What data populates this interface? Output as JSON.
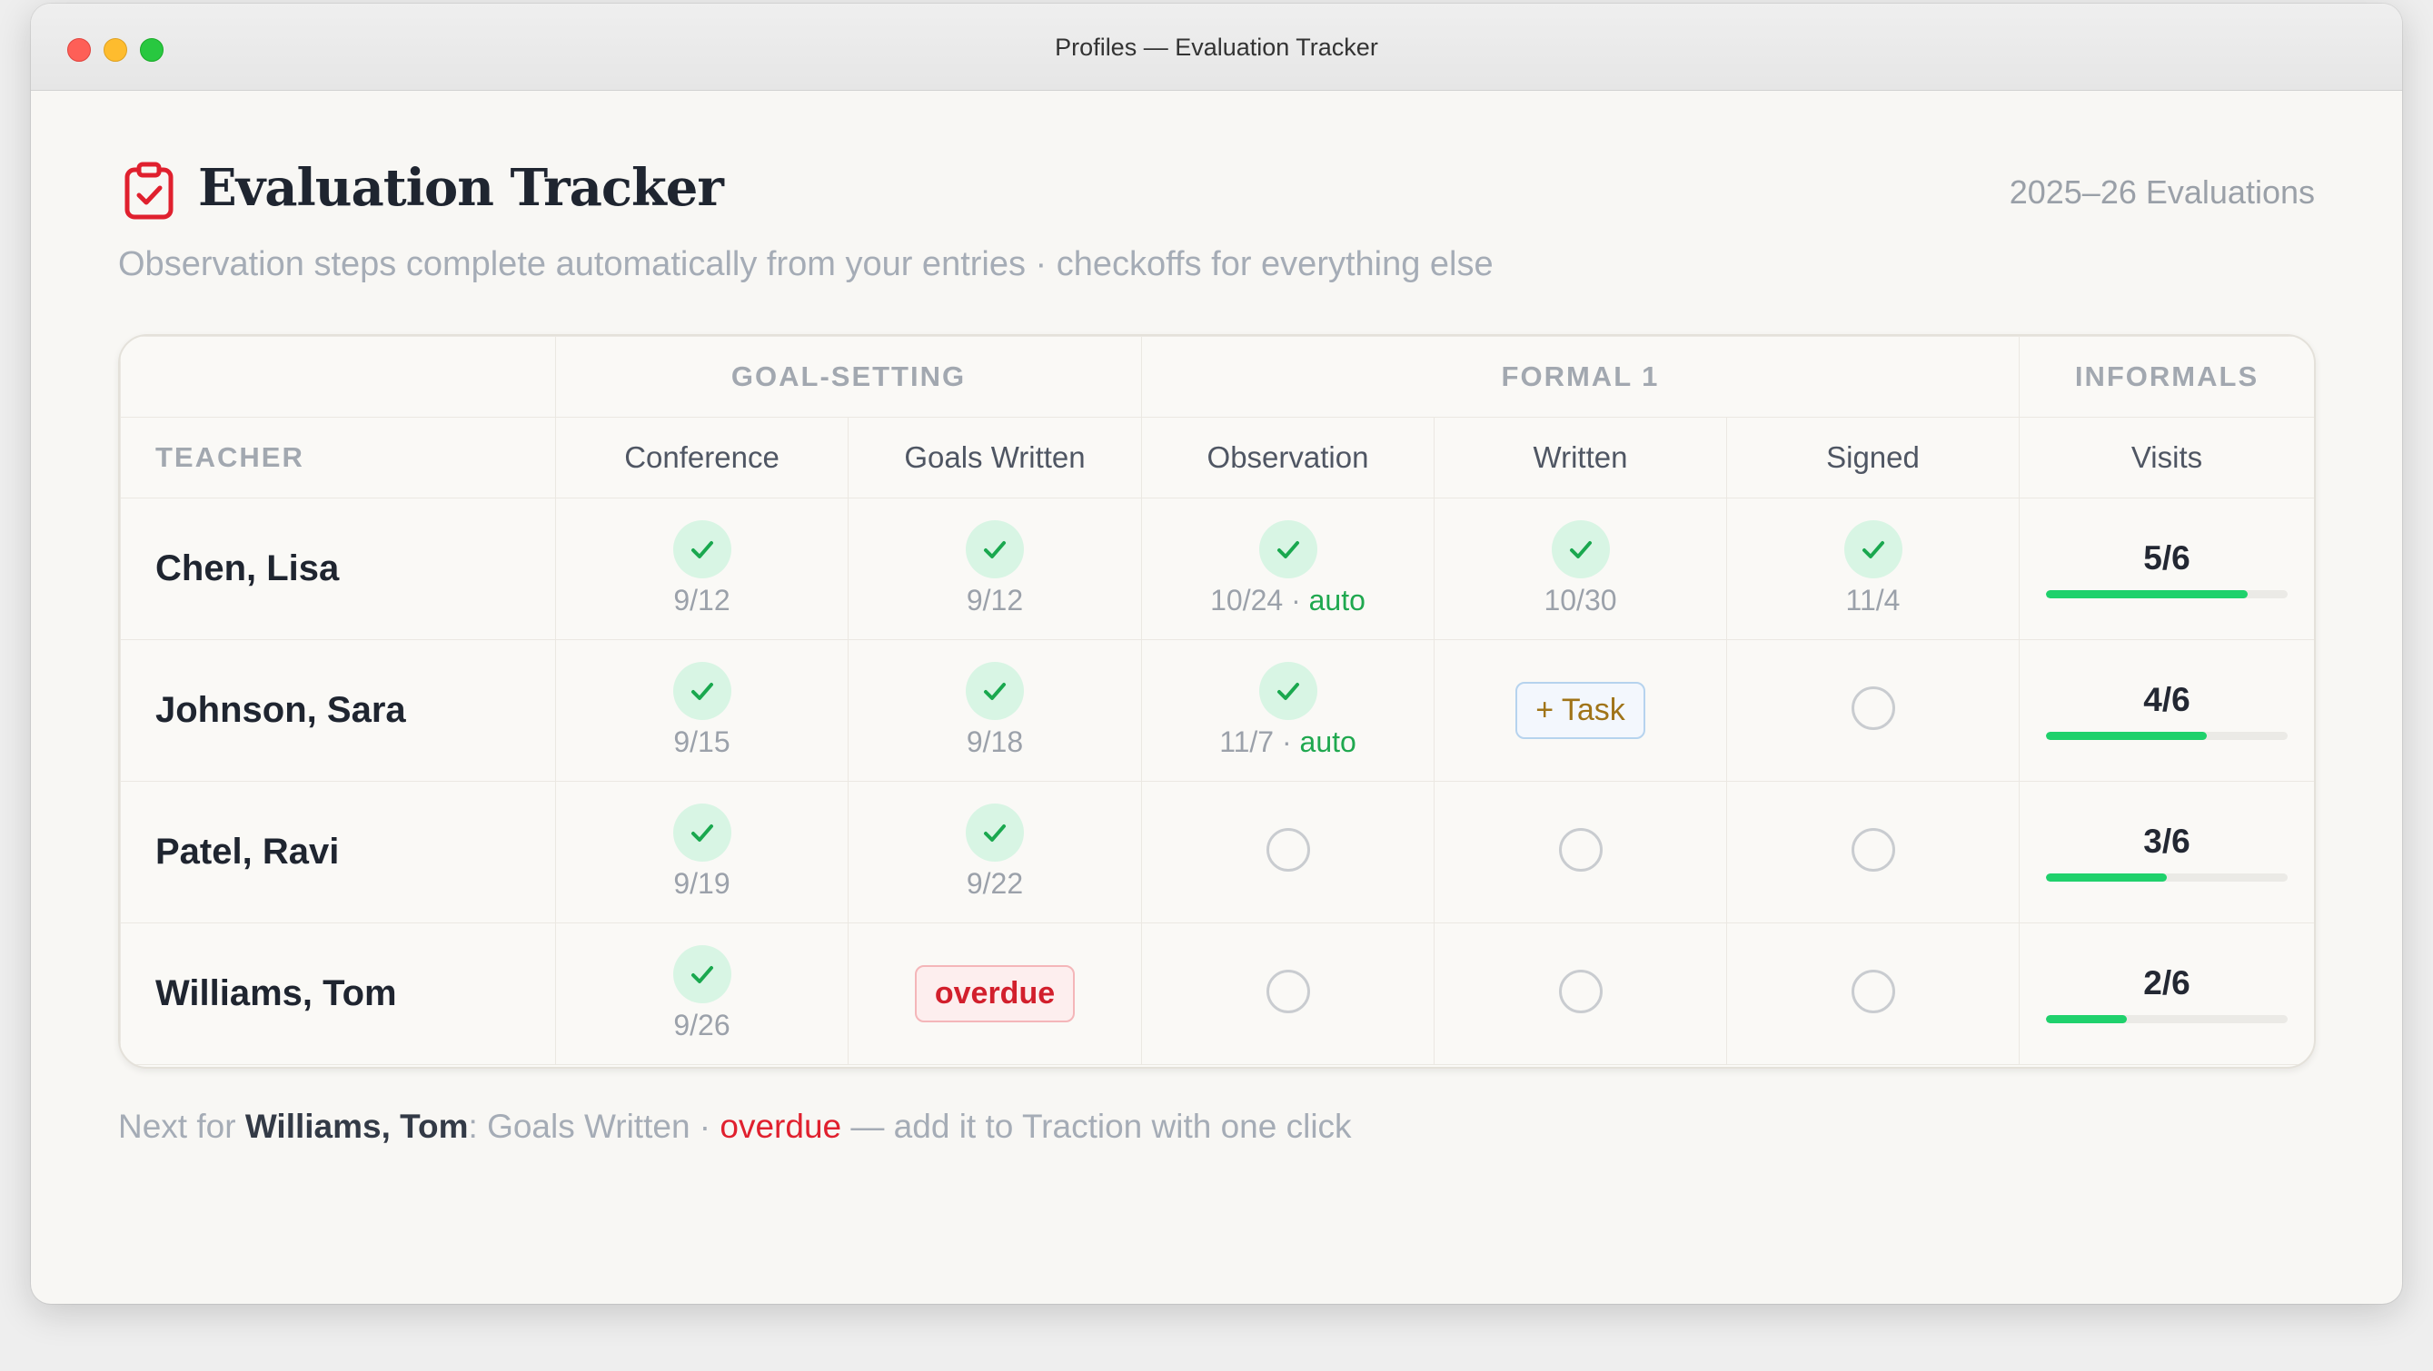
{
  "window": {
    "title": "Profiles — Evaluation Tracker"
  },
  "header": {
    "title": "Evaluation Tracker",
    "year": "2025–26 Evaluations",
    "subtitle": "Observation steps complete automatically from your entries · checkoffs for everything else"
  },
  "table": {
    "groups": [
      "GOAL-SETTING",
      "FORMAL 1",
      "INFORMALS"
    ],
    "columns": [
      "TEACHER",
      "Conference",
      "Goals Written",
      "Observation",
      "Written",
      "Signed",
      "Visits"
    ],
    "rows": [
      {
        "name": "Chen, Lisa",
        "conference": "9/12",
        "goals": "9/12",
        "observation": "10/24",
        "obs_auto": "auto",
        "written": "10/30",
        "signed": "11/4",
        "visits": "5/6",
        "visits_frac": 0.833
      },
      {
        "name": "Johnson, Sara",
        "conference": "9/15",
        "goals": "9/18",
        "observation": "11/7",
        "obs_auto": "auto",
        "written_task": "+ Task",
        "visits": "4/6",
        "visits_frac": 0.667
      },
      {
        "name": "Patel, Ravi",
        "conference": "9/19",
        "goals": "9/22",
        "visits": "3/6",
        "visits_frac": 0.5
      },
      {
        "name": "Williams, Tom",
        "conference": "9/26",
        "goals_status": "overdue",
        "visits": "2/6",
        "visits_frac": 0.333
      }
    ]
  },
  "footer": {
    "prefix": "Next for ",
    "teacher": "Williams, Tom",
    "step": ": Goals Written · ",
    "status": "overdue",
    "suffix": " — add it to Traction with one click"
  },
  "colors": {
    "accent_green": "#1fd16c",
    "overdue_red": "#e0202e",
    "icon_red": "#e0202e"
  }
}
